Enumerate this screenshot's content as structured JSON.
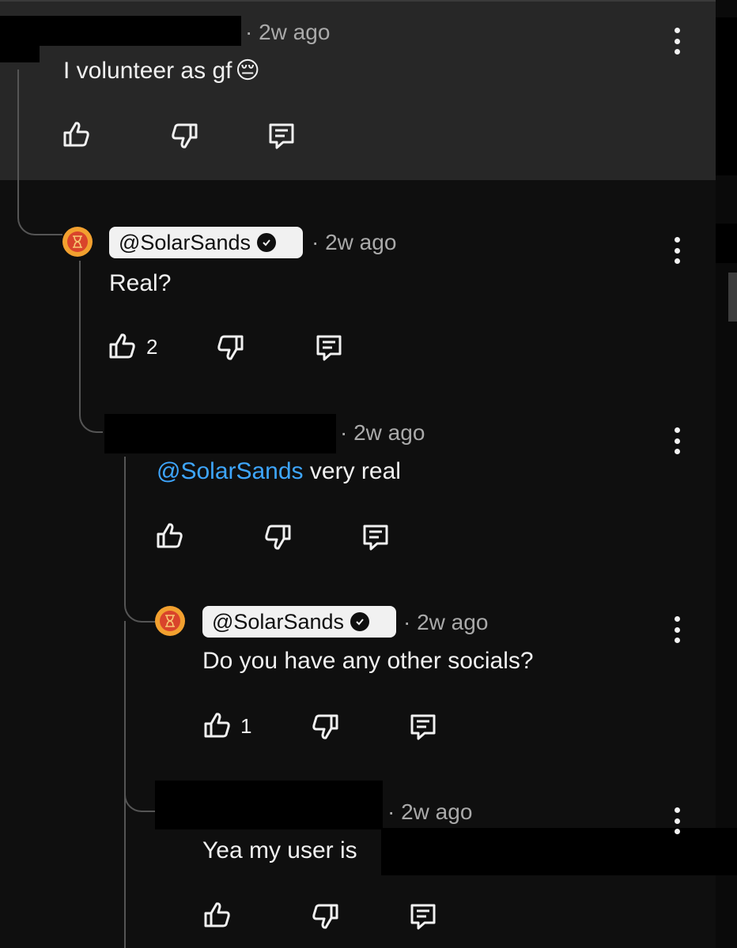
{
  "comments": [
    {
      "time": "· 2w ago",
      "text": "I volunteer as gf",
      "emoji": "😔",
      "likes": ""
    },
    {
      "handle": "@SolarSands",
      "time": "· 2w ago",
      "text": "Real?",
      "likes": "2"
    },
    {
      "time": "· 2w ago",
      "mention": "@SolarSands",
      "text": " very real",
      "likes": ""
    },
    {
      "handle": "@SolarSands",
      "time": "· 2w ago",
      "text": "Do you have any other socials?",
      "likes": "1"
    },
    {
      "time": "· 2w ago",
      "text": "Yea my user is",
      "likes": ""
    }
  ],
  "icons": {
    "like": "thumbs-up-icon",
    "dislike": "thumbs-down-icon",
    "reply": "reply-icon",
    "more": "more-vert-icon",
    "verified": "verified-check-icon"
  },
  "colors": {
    "background": "#0f0f0f",
    "highlight": "#272727",
    "mention": "#3ea6ff",
    "avatar": "#f2a02f"
  }
}
